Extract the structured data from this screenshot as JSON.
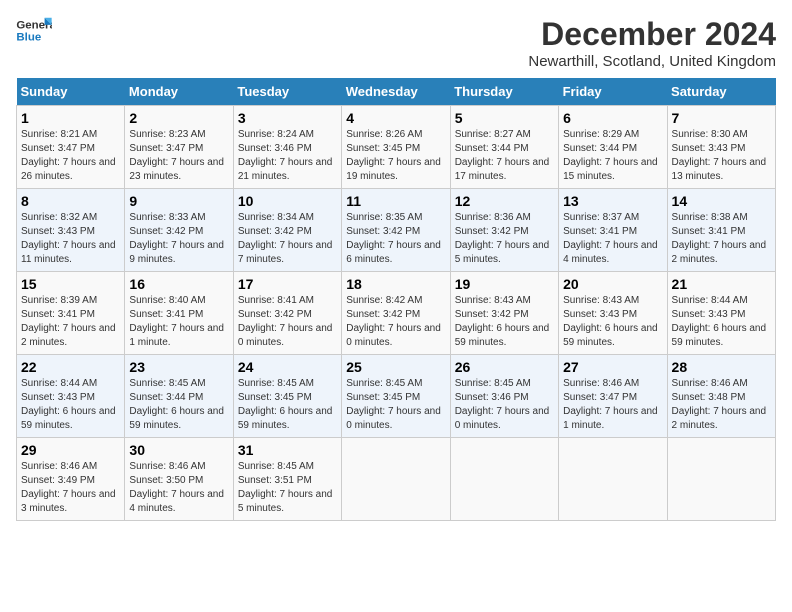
{
  "logo": {
    "line1": "General",
    "line2": "Blue"
  },
  "title": "December 2024",
  "location": "Newarthill, Scotland, United Kingdom",
  "days_of_week": [
    "Sunday",
    "Monday",
    "Tuesday",
    "Wednesday",
    "Thursday",
    "Friday",
    "Saturday"
  ],
  "weeks": [
    [
      {
        "day": "1",
        "sunrise": "8:21 AM",
        "sunset": "3:47 PM",
        "daylight": "7 hours and 26 minutes."
      },
      {
        "day": "2",
        "sunrise": "8:23 AM",
        "sunset": "3:47 PM",
        "daylight": "7 hours and 23 minutes."
      },
      {
        "day": "3",
        "sunrise": "8:24 AM",
        "sunset": "3:46 PM",
        "daylight": "7 hours and 21 minutes."
      },
      {
        "day": "4",
        "sunrise": "8:26 AM",
        "sunset": "3:45 PM",
        "daylight": "7 hours and 19 minutes."
      },
      {
        "day": "5",
        "sunrise": "8:27 AM",
        "sunset": "3:44 PM",
        "daylight": "7 hours and 17 minutes."
      },
      {
        "day": "6",
        "sunrise": "8:29 AM",
        "sunset": "3:44 PM",
        "daylight": "7 hours and 15 minutes."
      },
      {
        "day": "7",
        "sunrise": "8:30 AM",
        "sunset": "3:43 PM",
        "daylight": "7 hours and 13 minutes."
      }
    ],
    [
      {
        "day": "8",
        "sunrise": "8:32 AM",
        "sunset": "3:43 PM",
        "daylight": "7 hours and 11 minutes."
      },
      {
        "day": "9",
        "sunrise": "8:33 AM",
        "sunset": "3:42 PM",
        "daylight": "7 hours and 9 minutes."
      },
      {
        "day": "10",
        "sunrise": "8:34 AM",
        "sunset": "3:42 PM",
        "daylight": "7 hours and 7 minutes."
      },
      {
        "day": "11",
        "sunrise": "8:35 AM",
        "sunset": "3:42 PM",
        "daylight": "7 hours and 6 minutes."
      },
      {
        "day": "12",
        "sunrise": "8:36 AM",
        "sunset": "3:42 PM",
        "daylight": "7 hours and 5 minutes."
      },
      {
        "day": "13",
        "sunrise": "8:37 AM",
        "sunset": "3:41 PM",
        "daylight": "7 hours and 4 minutes."
      },
      {
        "day": "14",
        "sunrise": "8:38 AM",
        "sunset": "3:41 PM",
        "daylight": "7 hours and 2 minutes."
      }
    ],
    [
      {
        "day": "15",
        "sunrise": "8:39 AM",
        "sunset": "3:41 PM",
        "daylight": "7 hours and 2 minutes."
      },
      {
        "day": "16",
        "sunrise": "8:40 AM",
        "sunset": "3:41 PM",
        "daylight": "7 hours and 1 minute."
      },
      {
        "day": "17",
        "sunrise": "8:41 AM",
        "sunset": "3:42 PM",
        "daylight": "7 hours and 0 minutes."
      },
      {
        "day": "18",
        "sunrise": "8:42 AM",
        "sunset": "3:42 PM",
        "daylight": "7 hours and 0 minutes."
      },
      {
        "day": "19",
        "sunrise": "8:43 AM",
        "sunset": "3:42 PM",
        "daylight": "6 hours and 59 minutes."
      },
      {
        "day": "20",
        "sunrise": "8:43 AM",
        "sunset": "3:43 PM",
        "daylight": "6 hours and 59 minutes."
      },
      {
        "day": "21",
        "sunrise": "8:44 AM",
        "sunset": "3:43 PM",
        "daylight": "6 hours and 59 minutes."
      }
    ],
    [
      {
        "day": "22",
        "sunrise": "8:44 AM",
        "sunset": "3:43 PM",
        "daylight": "6 hours and 59 minutes."
      },
      {
        "day": "23",
        "sunrise": "8:45 AM",
        "sunset": "3:44 PM",
        "daylight": "6 hours and 59 minutes."
      },
      {
        "day": "24",
        "sunrise": "8:45 AM",
        "sunset": "3:45 PM",
        "daylight": "6 hours and 59 minutes."
      },
      {
        "day": "25",
        "sunrise": "8:45 AM",
        "sunset": "3:45 PM",
        "daylight": "7 hours and 0 minutes."
      },
      {
        "day": "26",
        "sunrise": "8:45 AM",
        "sunset": "3:46 PM",
        "daylight": "7 hours and 0 minutes."
      },
      {
        "day": "27",
        "sunrise": "8:46 AM",
        "sunset": "3:47 PM",
        "daylight": "7 hours and 1 minute."
      },
      {
        "day": "28",
        "sunrise": "8:46 AM",
        "sunset": "3:48 PM",
        "daylight": "7 hours and 2 minutes."
      }
    ],
    [
      {
        "day": "29",
        "sunrise": "8:46 AM",
        "sunset": "3:49 PM",
        "daylight": "7 hours and 3 minutes."
      },
      {
        "day": "30",
        "sunrise": "8:46 AM",
        "sunset": "3:50 PM",
        "daylight": "7 hours and 4 minutes."
      },
      {
        "day": "31",
        "sunrise": "8:45 AM",
        "sunset": "3:51 PM",
        "daylight": "7 hours and 5 minutes."
      },
      null,
      null,
      null,
      null
    ]
  ],
  "labels": {
    "sunrise": "Sunrise:",
    "sunset": "Sunset:",
    "daylight": "Daylight:"
  }
}
